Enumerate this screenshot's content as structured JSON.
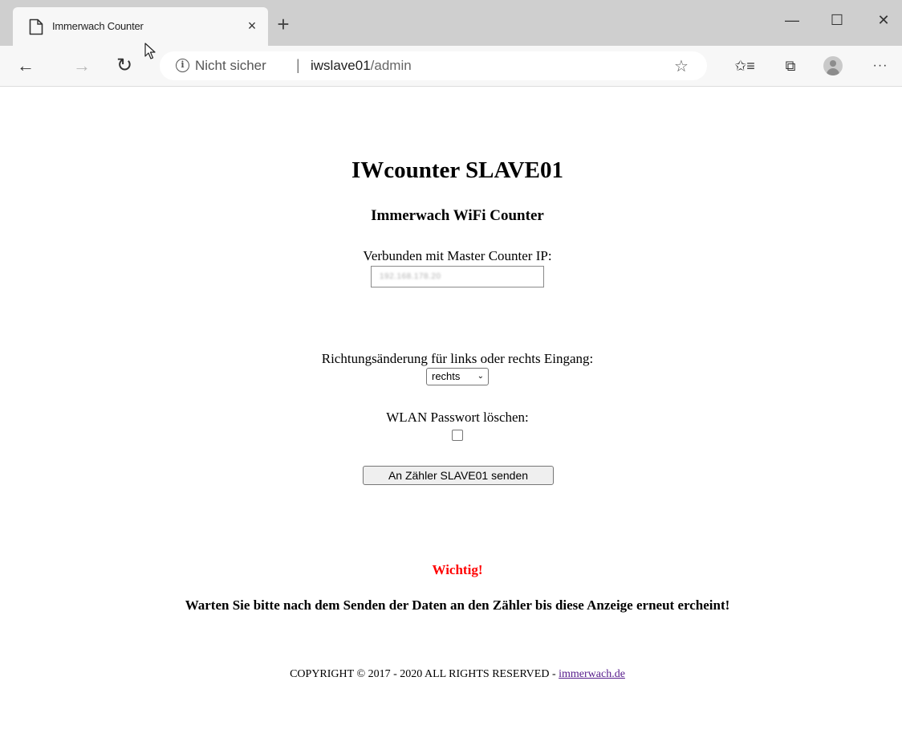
{
  "browser": {
    "tab": {
      "title": "Immerwach Counter",
      "close_glyph": "×",
      "icon": "page-icon"
    },
    "new_tab_glyph": "+",
    "window_controls": {
      "minimize_glyph": "—",
      "maximize_glyph": "☐",
      "close_glyph": "✕"
    },
    "nav": {
      "back_glyph": "←",
      "forward_glyph": "→",
      "refresh_glyph": "↻"
    },
    "address": {
      "info_glyph": "i",
      "security_text": "Nicht sicher",
      "separator": "|",
      "host": "iwslave01",
      "path": "/admin"
    },
    "toolbar_icons": {
      "favorite_glyph": "☆",
      "favorites_glyph": "✩≡",
      "collections_glyph": "⧉",
      "more_glyph": "···"
    }
  },
  "page": {
    "title": "IWcounter SLAVE01",
    "subtitle": "Immerwach WiFi Counter",
    "ip": {
      "label": "Verbunden mit Master Counter IP:",
      "value": "192.168.178.20"
    },
    "direction": {
      "label": "Richtungsänderung für links oder rechts Eingang:",
      "selected": "rechts",
      "chevron": "⌄"
    },
    "wlan": {
      "label": "WLAN Passwort löschen:",
      "checked": false
    },
    "send_button": "An Zähler SLAVE01 senden",
    "important": "Wichtig!",
    "warning": "Warten Sie bitte nach dem Senden der Daten an den Zähler bis diese Anzeige erneut ercheint!",
    "footer": {
      "text": "COPYRIGHT © 2017 - 2020 ALL RIGHTS RESERVED - ",
      "link": "immerwach.de"
    }
  },
  "colors": {
    "important": "#ff0000",
    "link": "#551a8b",
    "tabstrip": "#cfcfcf",
    "toolbar": "#f7f7f7"
  }
}
